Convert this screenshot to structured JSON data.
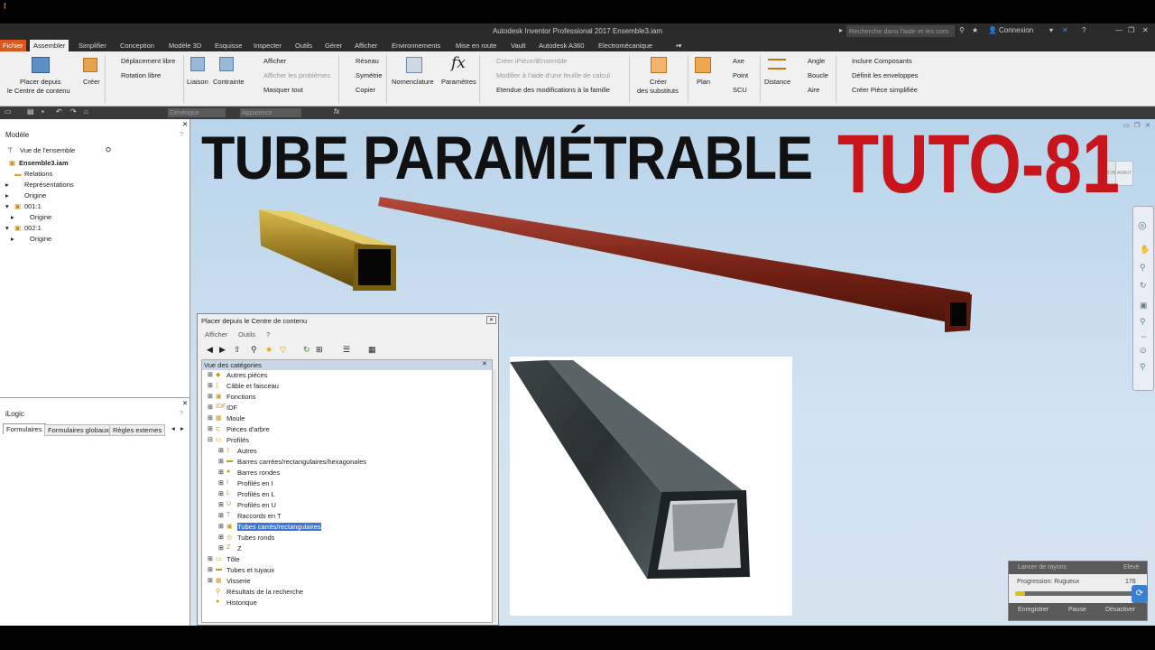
{
  "window": {
    "title": "Autodesk Inventor Professional 2017    Ensemble3.iam",
    "search_placeholder": "Recherche dans l'aide et les com",
    "connexion": "Connexion"
  },
  "tabs": [
    "Fichier",
    "Assembler",
    "Simplifier",
    "Conception",
    "Modèle 3D",
    "Esquisse",
    "Inspecter",
    "Outils",
    "Gérer",
    "Afficher",
    "Environnements",
    "Mise en route",
    "Vault",
    "Autodesk A360",
    "Electromécanique"
  ],
  "ribbon": {
    "placer": "Placer depuis",
    "placer2": "le Centre de contenu",
    "creer": "Créer",
    "deplacement": "Déplacement libre",
    "rotation": "Rotation libre",
    "liaison": "Liaison",
    "contrainte": "Contrainte",
    "afficher": "Afficher",
    "afficher_problemes": "Afficher les problèmes",
    "masquer": "Masquer tout",
    "reseau": "Réseau",
    "symetrie": "Symétrie",
    "copier": "Copier",
    "nomenclature": "Nomenclature",
    "parametres": "Paramètres",
    "creer_ipiece": "Créer iPièce/iEnsemble",
    "modifier_feuille": "Modifier à l'aide d'une feuille de calcul",
    "etendue": "Etendue des modifications à la famille",
    "creer_substituts": "Créer",
    "creer_substituts2": "des substituts",
    "plan": "Plan",
    "axe": "Axe",
    "point": "Point",
    "scu": "SCU",
    "distance": "Distance",
    "angle": "Angle",
    "boucle": "Boucle",
    "aire": "Aire",
    "inclure": "Inclure Composants",
    "definit": "Définit les enveloppes",
    "creer_piece": "Créer Pièce simplifiée"
  },
  "toolbar2": {
    "material": "Générique",
    "appearance": "Apparence"
  },
  "model_panel": {
    "title": "Modèle",
    "view": "Vue de l'ensemble",
    "root": "Ensemble3.iam",
    "items": [
      "Relations",
      "Représentations",
      "Origine",
      "001:1",
      "Origine",
      "002:1",
      "Origine"
    ]
  },
  "ilogic": {
    "title": "iLogic",
    "tabs": [
      "Formulaires",
      "Formulaires globaux",
      "Règles externes"
    ]
  },
  "overlay": {
    "title": "TUBE PARAMÉTRABLE",
    "tuto": "TUTO-81"
  },
  "viewcube": {
    "gauche": "GAUCHE",
    "avant": "AVANT"
  },
  "dialog": {
    "title": "Placer depuis le Centre de contenu",
    "menu": [
      "Afficher",
      "Outils",
      "?"
    ],
    "tree_header": "Vue des catégories",
    "items": [
      {
        "label": "Autres pièces",
        "level": 0
      },
      {
        "label": "Câble et faisceau",
        "level": 0
      },
      {
        "label": "Fonctions",
        "level": 0
      },
      {
        "label": "IDF",
        "level": 0
      },
      {
        "label": "Moule",
        "level": 0
      },
      {
        "label": "Pièces d'arbre",
        "level": 0
      },
      {
        "label": "Profilés",
        "level": 0
      },
      {
        "label": "Autres",
        "level": 1
      },
      {
        "label": "Barres carrées/rectangulaires/hexagonales",
        "level": 1
      },
      {
        "label": "Barres rondes",
        "level": 1
      },
      {
        "label": "Profilés en I",
        "level": 1
      },
      {
        "label": "Profilés en L",
        "level": 1
      },
      {
        "label": "Profilés en U",
        "level": 1
      },
      {
        "label": "Raccords en T",
        "level": 1
      },
      {
        "label": "Tubes carrés/rectangulaires",
        "level": 1,
        "selected": true
      },
      {
        "label": "Tubes ronds",
        "level": 1
      },
      {
        "label": "Z",
        "level": 1
      },
      {
        "label": "Tôle",
        "level": 0
      },
      {
        "label": "Tubes et tuyaux",
        "level": 0
      },
      {
        "label": "Visserie",
        "level": 0
      },
      {
        "label": "Résultats de la recherche",
        "level": 0
      },
      {
        "label": "Historique",
        "level": 0
      }
    ]
  },
  "progress": {
    "header": "Lancer de rayons",
    "right": "Elevé",
    "label": "Progression: Rugueux",
    "value": "178",
    "fraction": 0.08,
    "buttons": [
      "Enregistrer",
      "Pause",
      "Désactiver"
    ]
  },
  "colors": {
    "accent": "#d9581a",
    "tuto": "#c8151c",
    "tube_red": "#7a2418",
    "tube_gold": "#8a6e1c"
  }
}
